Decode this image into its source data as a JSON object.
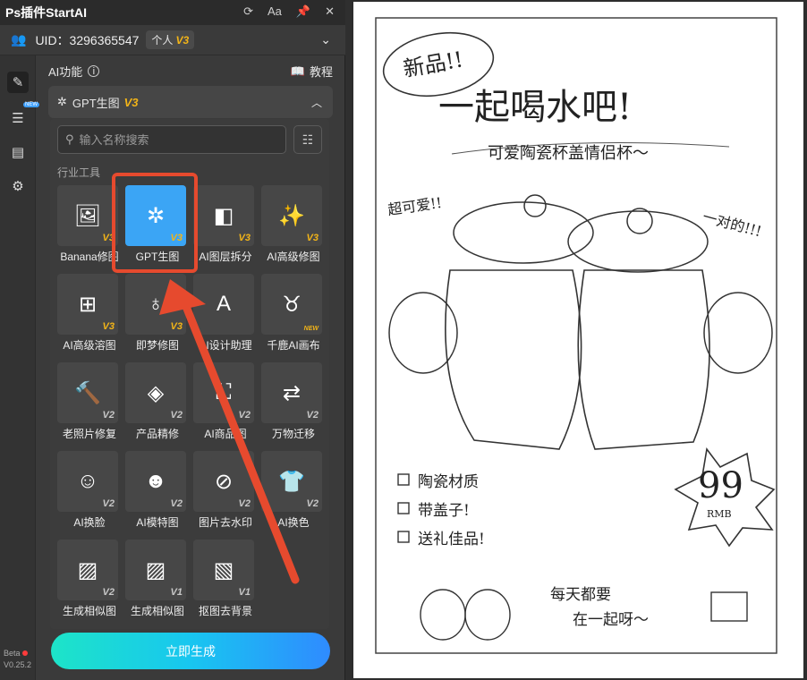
{
  "window": {
    "title": "Ps插件StartAI"
  },
  "user": {
    "uid": "UID：3296365547",
    "plan": "个人",
    "plan_version": "V3"
  },
  "section": {
    "title": "AI功能",
    "tutorial": "教程"
  },
  "current_tool": {
    "name": "GPT生图",
    "version": "V3"
  },
  "search": {
    "placeholder": "输入名称搜索"
  },
  "category": "行业工具",
  "tools": [
    {
      "label": "Banana修图",
      "version": "V3"
    },
    {
      "label": "GPT生图",
      "version": "V3"
    },
    {
      "label": "AI图层拆分",
      "version": "V3"
    },
    {
      "label": "AI高级修图",
      "version": "V3"
    },
    {
      "label": "AI高级溶图",
      "version": "V3"
    },
    {
      "label": "即梦修图",
      "version": "V3"
    },
    {
      "label": "AI设计助理",
      "version": ""
    },
    {
      "label": "千鹿AI画布",
      "version": "NEW"
    },
    {
      "label": "老照片修复",
      "version": "V2"
    },
    {
      "label": "产品精修",
      "version": "V2"
    },
    {
      "label": "AI商品图",
      "version": "V2"
    },
    {
      "label": "万物迁移",
      "version": "V2"
    },
    {
      "label": "AI换脸",
      "version": "V2"
    },
    {
      "label": "AI模特图",
      "version": "V2"
    },
    {
      "label": "图片去水印",
      "version": "V2"
    },
    {
      "label": "AI换色",
      "version": "V2"
    },
    {
      "label": "生成相似图",
      "version": "V2"
    },
    {
      "label": "生成相似图",
      "version": "V1"
    },
    {
      "label": "抠图去背景",
      "version": "V1"
    }
  ],
  "generate_button": "立即生成",
  "version": {
    "beta": "Beta",
    "number": "V0.25.2"
  },
  "poster": {
    "badge": "新品!!",
    "headline": "一起喝水吧!",
    "subhead": "可爱陶瓷杯盖情侣杯～",
    "note_left": "超可爱!!",
    "note_right": "一对的!!!",
    "features": [
      "陶瓷材质",
      "带盖子!",
      "送礼佳品!"
    ],
    "price": "99",
    "currency": "RMB",
    "footer_line1": "每天都要",
    "footer_line2": "在一起呀～"
  },
  "colors": {
    "accent": "#3ba5f5",
    "version_gold": "#f2b418",
    "highlight": "#e64a2e"
  }
}
